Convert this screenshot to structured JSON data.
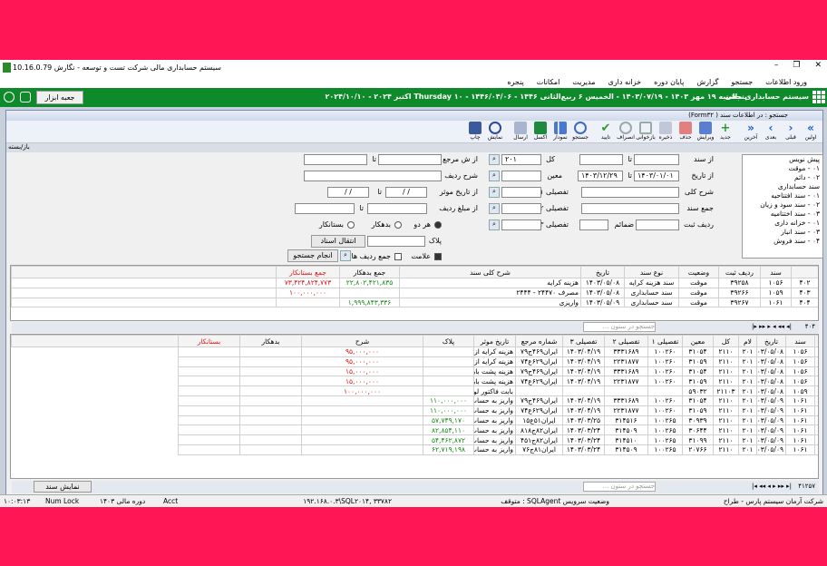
{
  "window": {
    "title": "سیستم حسابداری مالی شرکت تست و توسعه - نگارش 10.16.0.79",
    "buttons": [
      "–",
      "❐",
      "✕"
    ]
  },
  "menu": [
    "ورود اطلاعات",
    "جستجو",
    "گزارش",
    "پایان دوره",
    "خزانه داری",
    "مدیریت",
    "امکانات",
    "پنجره"
  ],
  "header": {
    "system": "سیستم حسابداری مالی",
    "date_line1": "پنجشنبه ۱۹ مهر ۱۴۰۳ - ۱۴۰۳/۰۷/۱۹ - الخمیس ۶ ربیع‌الثانی ۱۴۴۶ - ۱۴۴۶/۰۴/۰۶ - Thursday ۱۰ اکتبر ۲۰۲۴ - ۲۰۲۴/۱۰/۱۰",
    "tools": "جعبه ابزار"
  },
  "inner": {
    "title": "جستجو : در اطلاعات سند ( Form۳۲)",
    "group": "باز/بسته"
  },
  "toolbar": [
    "اولین",
    "قبلی",
    "بعدی",
    "آخرین",
    "جدید",
    "ویرایش",
    "حذف",
    "ذخیره",
    "بازخوانی",
    "انصراف",
    "تایید",
    "جستجو",
    "نمودار",
    "اکسل",
    "ارسال",
    "نمایش",
    "چاپ"
  ],
  "filters": {
    "from_doc": "از سند",
    "to": "تا",
    "from_date": "از تاریخ",
    "date_from": "۱۴۰۳/۰۱/۰۱",
    "date_to": "۱۴۰۳/۱۲/۲۹",
    "general_desc": "شرح کلی",
    "doc_total": "جمع سند",
    "row_type": "ردیف ثبت",
    "attachments": "ضمائم",
    "kol": "کل",
    "kol_val": "۲۰۱",
    "moein": "معین",
    "tafsili1": "تفصیلی ۱",
    "tafsili2": "تفصیلی ۲",
    "tafsili3": "تفصیلی ۳",
    "from_ref": "از ش مرجع",
    "row_desc": "شرح ردیف",
    "from_eff_date": "از تاریخ موثر",
    "date_blank": "/ /",
    "from_amount": "از مبلغ ردیف",
    "r_both": "هر دو",
    "r_debit": "بدهکار",
    "r_credit": "بستانکار",
    "plak": "پلاک",
    "transfer": "انتقال اسناد",
    "mark": "علامت",
    "sum_rows": "جمع ردیف ها",
    "search_btn": "انجام جستجو"
  },
  "tree": [
    "پیش نویس",
    "۰۱ - موقت",
    "۰۲ - دائم",
    "سند حسابداری",
    "۰۱ - سند افتتاحیه",
    "۰۲ - سند سود و زیان",
    "۰۳ - سند اختتامیه",
    "۰۱ - خزانه داری",
    "۰۳ - سند انبار",
    "۰۴ - سند فروش"
  ],
  "grid1": {
    "headers": [
      "سند",
      "ردیف ثبت",
      "وضعیت",
      "نوع سند",
      "تاریخ",
      "شرح کلی سند",
      "جمع بدهکار",
      "جمع بستانکار"
    ],
    "rows": [
      [
        "۴۰۲",
        "۱۰۵۶",
        "۳۹۲۵۸",
        "موقت",
        "سند هزینه کرایه",
        "۱۴۰۳/۰۵/۰۸",
        "هزینه کرایه",
        "۲۲,۸۰۲,۴۲۱,۸۳۵",
        "۷۳,۴۲۴,۸۲۴,۷۷۳"
      ],
      [
        "۴۰۳",
        "۱۰۵۹",
        "۳۹۲۶۶",
        "موقت",
        "سند حسابداری",
        "۱۴۰۳/۰۵/۰۸",
        "مصرف ۲۴۴۷۰ - ۲۴۴۴",
        "",
        "۱۰۰,۰۰۰,۰۰۰"
      ],
      [
        "۴۰۴",
        "۱۰۶۱",
        "۳۹۲۶۷",
        "موقت",
        "سند حسابداری",
        "۱۴۰۳/۰۵/۰۹",
        "واریزی",
        "۱,۹۹۹,۸۴۳,۳۳۶",
        ""
      ]
    ],
    "count": "۴۰۴"
  },
  "grid2": {
    "headers": [
      "سند",
      "تاریخ",
      "لام",
      "کل",
      "معین",
      "تفصیلی ۱",
      "تفصیلی ۲",
      "تفصیلی ۳",
      "شماره مرجع",
      "تاریخ موثر",
      "پلاک",
      "شرح",
      "بدهکار",
      "بستانکار"
    ],
    "rows": [
      [
        "۴۱۲۳۵",
        "۱۰۵۶",
        "۱۴۰۳/۰۵/۰۸",
        "۲۰۱",
        "۲۱۱۰",
        "۳۱۰۵۴",
        "۱۰۰۲۶۰",
        "۳۳۳۱۶۸۹",
        "۱۴۰۳/۰۴/۱۹",
        "ایران۴۶۹ج۷۹",
        "هزینه کرایه  از بندرعباس به تهران",
        "",
        "۹۵,۰۰۰,۰۰۰"
      ],
      [
        "۴۱۲۳۶",
        "۱۰۵۶",
        "۱۴۰۳/۰۵/۰۸",
        "۲۰۱",
        "۲۱۱۰",
        "۳۱۰۵۹",
        "۱۰۰۲۶۰",
        "۲۲۳۱۸۷۷",
        "۱۴۰۳/۰۴/۱۹",
        "ایران۶۲۹ع۷۴",
        "هزینه کرایه  از بندرعباس به تهران",
        "",
        "۹۵,۰۰۰,۰۰۰"
      ],
      [
        "۴۱۲۳۷",
        "۱۰۵۶",
        "۱۴۰۳/۰۵/۰۸",
        "۲۰۱",
        "۲۱۱۰",
        "۳۱۰۵۴",
        "۱۰۰۲۶۰",
        "۳۳۳۱۶۸۹",
        "۱۴۰۳/۰۴/۱۹",
        "ایران۴۶۹ج۷۹",
        "هزینه پشت بارنامه  از بندرعباس به",
        "",
        "۱۵,۰۰۰,۰۰۰"
      ],
      [
        "۴۱۲۳۸",
        "۱۰۵۶",
        "۱۴۰۳/۰۵/۰۸",
        "۲۰۱",
        "۲۱۱۰",
        "۳۱۰۵۹",
        "۱۰۰۲۶۰",
        "۲۲۳۱۸۷۷",
        "۱۴۰۳/۰۴/۱۹",
        "ایران۶۲۹ع۷۴",
        "هزینه پشت بارنامه  از بندرعباس به",
        "",
        "۱۵,۰۰۰,۰۰۰"
      ],
      [
        "۴۱۲۳۹",
        "۱۰۵۹",
        "۱۴۰۳/۰۵/۰۸",
        "۲۰۱",
        "۲۱۱۰۳",
        "۵۹۰۳۲",
        "",
        "",
        "",
        "",
        "بابت فاکتور لوازم چرخ و بر ۲۴۴۷۰",
        "",
        "۱۰۰,۰۰۰,۰۰۰"
      ],
      [
        "۴۱۲۴۰",
        "۱۰۶۱",
        "۱۴۰۳/۰۵/۰۹",
        "۲۰۱",
        "۲۱۱۰",
        "۳۱۰۵۴",
        "۱۰۰۲۶۰",
        "۳۳۳۱۶۸۹",
        "۱۴۰۳/۰۴/۱۹",
        "ایران۴۶۹ج۷۹",
        "واریز به حساب  از بندرعباس به تهران",
        "۱۱۰,۰۰۰,۰۰۰",
        ""
      ],
      [
        "۴۱۲۴۱",
        "۱۰۶۱",
        "۱۴۰۳/۰۵/۰۹",
        "۲۰۱",
        "۲۱۱۰",
        "۳۱۰۵۹",
        "۱۰۰۲۶۰",
        "۲۲۳۱۸۷۷",
        "۱۴۰۳/۰۴/۱۹",
        "ایران۶۲۹ع۷۴",
        "واریز به حساب  از بندرعباس به تهران",
        "۱۱۰,۰۰۰,۰۰۰",
        ""
      ],
      [
        "۴۱۲۴۲",
        "۱۰۶۱",
        "۱۴۰۳/۰۵/۰۹",
        "۲۰۱",
        "۲۱۱۰",
        "۳۰۹۳۹",
        "۱۰۰۲۶۵",
        "۳۱۴۵۱۶",
        "۱۴۰۳/۰۳/۲۵",
        "ایران۵۱ع۱۵",
        "واریز به حساب  از اراک به بندرعباس",
        "۵۷,۷۴۹,۱۷۰",
        ""
      ],
      [
        "۴۱۲۴۳",
        "۱۰۶۱",
        "۱۴۰۳/۰۵/۰۹",
        "۲۰۱",
        "۲۱۱۰",
        "۳۰۶۴۴",
        "۱۰۰۲۶۵",
        "۳۱۴۵۰۹",
        "۱۴۰۳/۰۳/۲۴",
        "ایران۸۲ج۸۱۸",
        "واریز به حساب  از اراک به بندرعباس",
        "۸۲,۸۵۴,۱۱۰",
        ""
      ],
      [
        "۴۱۲۴۴",
        "۱۰۶۱",
        "۱۴۰۳/۰۵/۰۹",
        "۲۰۱",
        "۲۱۱۰",
        "۳۱۰۹۹",
        "۱۰۰۲۶۵",
        "۳۱۴۵۱۰",
        "۱۴۰۳/۰۳/۲۴",
        "ایران۸۲ج۴۵۱",
        "واریز به حساب  از اراک به بندرعباس",
        "۵۴,۴۶۲,۸۷۲",
        ""
      ],
      [
        "۴۱۲۴۵",
        "۱۰۶۱",
        "۱۴۰۳/۰۵/۰۹",
        "۲۰۱",
        "۲۱۱۰",
        "۲۰۷۶۶",
        "۱۰۰۲۶۵",
        "۳۱۴۵۰۹",
        "۱۴۰۳/۰۳/۲۴",
        "ایران۸۱ج۷۶",
        "واریز به حساب  از اراک به بندرعباس",
        "۶۲,۷۱۹,۱۹۸",
        ""
      ]
    ],
    "count": "۴۱۲۵۷"
  },
  "search_placeholder": "جستجو در ستون ...",
  "show_doc": "نمایش سند",
  "status": {
    "company": "شرکت آرمان سیستم پارس - طراح",
    "service": "متوقف : SQLAgent وضعیت سرویس",
    "server": "۱۹۲.۱۶۸.۰.۳\\SQL۲۰۱۴, ۳۳۷۸۲",
    "acct": "Acct",
    "period": "دوره مالی ۱۴۰۳",
    "numlock": "Num Lock",
    "time": "۱۰:۰۳:۱۳"
  }
}
